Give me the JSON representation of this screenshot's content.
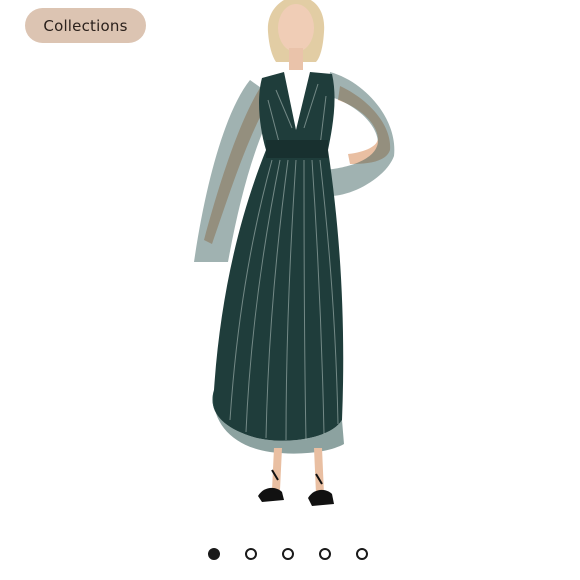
{
  "header": {
    "collections_label": "Collections"
  },
  "gallery": {
    "image_subject": "model-in-dark-green-metallic-stripe-maxi-dress",
    "slides": [
      {
        "active": true
      },
      {
        "active": false
      },
      {
        "active": false
      },
      {
        "active": false
      },
      {
        "active": false
      }
    ]
  },
  "colors": {
    "button_bg": "#dcc4b2",
    "dress": "#1f3d3b",
    "dot": "#1a1a1a"
  }
}
